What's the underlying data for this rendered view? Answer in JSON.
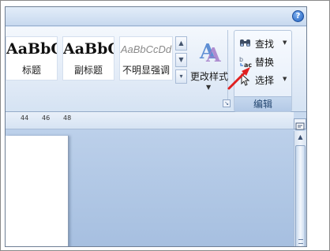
{
  "help": {
    "glyph": "?"
  },
  "styles_gallery": {
    "tiles": [
      {
        "sample": "AaBbC",
        "name": "标题"
      },
      {
        "sample": "AaBbC",
        "name": "副标题"
      },
      {
        "sample": "AaBbCcDd",
        "name": "不明显强调"
      }
    ],
    "scroll_up": "▲",
    "scroll_down": "▼",
    "more": "▾"
  },
  "change_styles": {
    "label": "更改样式",
    "caret": "▼"
  },
  "dialog_launcher": {
    "glyph": "↘"
  },
  "editing": {
    "find_label": "查找",
    "replace_label": "替换",
    "select_label": "选择",
    "caret": "▼",
    "group_label": "编辑"
  },
  "ruler": {
    "ticks": [
      "44",
      "46",
      "48"
    ]
  },
  "scrollbar": {
    "up": "▲"
  },
  "colors": {
    "ribbon": "#dfe9f6",
    "workspace": "#a6bfe0",
    "annotation": "#e02020"
  }
}
